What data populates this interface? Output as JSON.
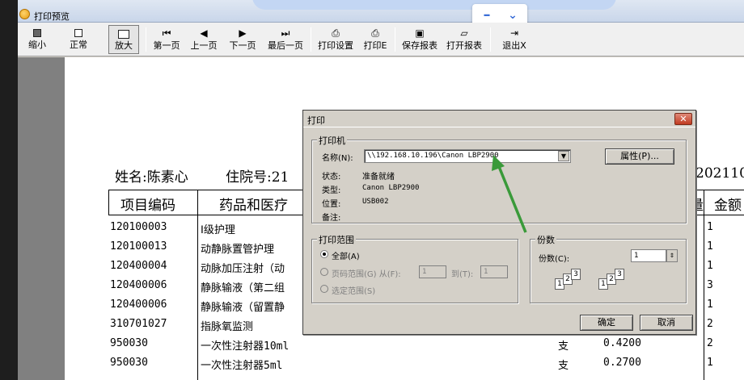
{
  "window": {
    "title": "打印预览"
  },
  "toolbar": {
    "buttons": [
      {
        "label": "缩小",
        "icon": "zoom-out-icon"
      },
      {
        "label": "正常",
        "icon": "page-normal-icon"
      },
      {
        "label": "放大",
        "icon": "zoom-in-icon"
      },
      {
        "label": "第一页",
        "icon": "first-page-icon"
      },
      {
        "label": "上一页",
        "icon": "prev-page-icon"
      },
      {
        "label": "下一页",
        "icon": "next-page-icon"
      },
      {
        "label": "最后一页",
        "icon": "last-page-icon"
      },
      {
        "label": "打印设置",
        "icon": "printer-setup-icon"
      },
      {
        "label": "打印E",
        "icon": "printer-icon"
      },
      {
        "label": "保存报表",
        "icon": "save-icon"
      },
      {
        "label": "打开报表",
        "icon": "open-folder-icon"
      },
      {
        "label": "退出X",
        "icon": "exit-door-icon"
      }
    ]
  },
  "report": {
    "patient_name": "姓名:陈素心",
    "admission_no": "住院号:21",
    "date_partial": "202110",
    "headers": {
      "code": "项目编码",
      "name": "药品和医疗",
      "qty": "量",
      "amount": "金额"
    },
    "rows": [
      {
        "code": "120100003",
        "name": "Ⅰ级护理",
        "unit": "",
        "price": "",
        "qty": "1"
      },
      {
        "code": "120100013",
        "name": "动静脉置管护理",
        "unit": "",
        "price": "",
        "qty": "1"
      },
      {
        "code": "120400004",
        "name": "动脉加压注射（动",
        "unit": "",
        "price": "",
        "qty": "1"
      },
      {
        "code": "120400006",
        "name": "静脉输液（第二组",
        "unit": "",
        "price": "",
        "qty": "3"
      },
      {
        "code": "120400006",
        "name": "静脉输液（留置静",
        "unit": "",
        "price": "",
        "qty": "1"
      },
      {
        "code": "310701027",
        "name": "指脉氧监测",
        "unit": "",
        "price": "",
        "qty": "2"
      },
      {
        "code": "950030",
        "name": "一次性注射器10ml",
        "unit": "支",
        "price": "0.4200",
        "qty": "2"
      },
      {
        "code": "950030",
        "name": "一次性注射器5ml",
        "unit": "支",
        "price": "0.2700",
        "qty": "1"
      }
    ]
  },
  "print_dialog": {
    "title": "打印",
    "printer_group": "打印机",
    "name_label": "名称(N):",
    "printer_name": "\\\\192.168.10.196\\Canon LBP2900",
    "properties_button": "属性(P)...",
    "status_label": "状态:",
    "status_value": "准备就绪",
    "type_label": "类型:",
    "type_value": "Canon LBP2900",
    "location_label": "位置:",
    "location_value": "USB002",
    "comment_label": "备注:",
    "range_group": "打印范围",
    "range_all": "全部(A)",
    "range_pages": "页码范围(G) 从(F):",
    "range_from": "1",
    "range_to_label": "到(T):",
    "range_to": "1",
    "range_selection": "选定范围(S)",
    "copies_group": "份数",
    "copies_label": "份数(C):",
    "copies_value": "1",
    "ok_button": "确定",
    "cancel_button": "取消"
  },
  "colors": {
    "arrow": "#3a9a3a",
    "accent": "#3b6fd8"
  }
}
